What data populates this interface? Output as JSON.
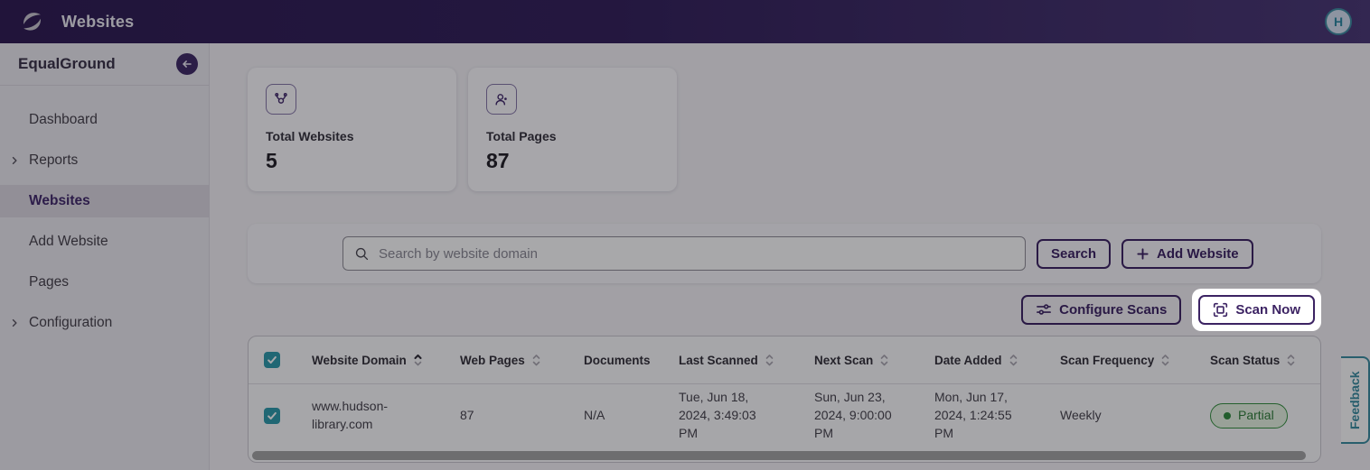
{
  "topbar": {
    "title": "Websites",
    "avatar_initial": "H"
  },
  "sidebar": {
    "workspace": "EqualGround",
    "items": [
      {
        "label": "Dashboard",
        "expandable": false,
        "active": false
      },
      {
        "label": "Reports",
        "expandable": true,
        "active": false
      },
      {
        "label": "Websites",
        "expandable": false,
        "active": true
      },
      {
        "label": "Add Website",
        "expandable": false,
        "active": false
      },
      {
        "label": "Pages",
        "expandable": false,
        "active": false
      },
      {
        "label": "Configuration",
        "expandable": true,
        "active": false
      }
    ]
  },
  "stats": [
    {
      "label": "Total Websites",
      "value": "5",
      "icon": "crawler-network-icon"
    },
    {
      "label": "Total Pages",
      "value": "87",
      "icon": "user-gear-icon"
    }
  ],
  "toolbar": {
    "search_placeholder": "Search by website domain",
    "search_button": "Search",
    "add_website_button": "Add Website",
    "configure_scans_button": "Configure Scans",
    "scan_now_button": "Scan Now"
  },
  "table": {
    "header_checkbox_checked": true,
    "columns": [
      {
        "label": "Website Domain",
        "sortable": true,
        "sort": "asc"
      },
      {
        "label": "Web Pages",
        "sortable": true,
        "sort": "none"
      },
      {
        "label": "Documents",
        "sortable": false,
        "sort": "none"
      },
      {
        "label": "Last Scanned",
        "sortable": true,
        "sort": "none"
      },
      {
        "label": "Next Scan",
        "sortable": true,
        "sort": "none"
      },
      {
        "label": "Date Added",
        "sortable": true,
        "sort": "none"
      },
      {
        "label": "Scan Frequency",
        "sortable": true,
        "sort": "none"
      },
      {
        "label": "Scan Status",
        "sortable": true,
        "sort": "none"
      }
    ],
    "rows": [
      {
        "selected": true,
        "domain": "www.hudson-library.com",
        "web_pages": "87",
        "documents": "N/A",
        "last_scanned": "Tue, Jun 18, 2024, 3:49:03 PM",
        "next_scan": "Sun, Jun 23, 2024, 9:00:00 PM",
        "date_added": "Mon, Jun 17, 2024, 1:24:55 PM",
        "scan_frequency": "Weekly",
        "scan_status": "Partial"
      }
    ]
  },
  "feedback_tab": "Feedback",
  "colors": {
    "accent": "#41286a",
    "teal": "#3a8da0",
    "checkbox_teal": "#2d9aab",
    "status_green": "#35913f",
    "topbar_start": "#2e1b52",
    "topbar_end": "#4a3875"
  }
}
